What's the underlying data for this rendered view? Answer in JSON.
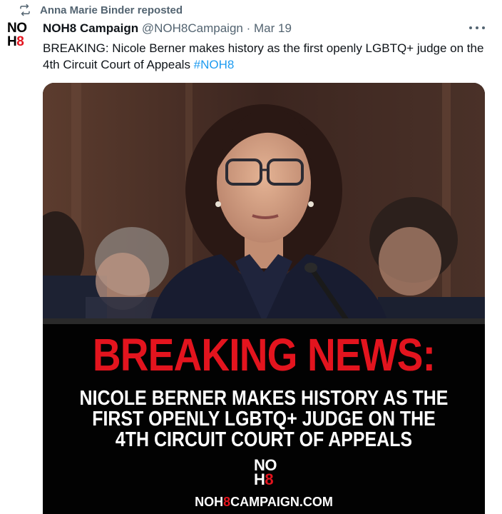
{
  "repost": {
    "icon": "repost-icon",
    "label": "Anna Marie Binder reposted"
  },
  "avatar": {
    "line1": "NO",
    "line2_prefix": "H",
    "line2_red": "8"
  },
  "author": {
    "name": "NOH8 Campaign",
    "handle": "@NOH8Campaign",
    "separator": "·",
    "date": "Mar 19"
  },
  "more_icon": "more-horizontal-icon",
  "post": {
    "text": "BREAKING: Nicole Berner makes history as the first openly LGBTQ+ judge on the 4th Circuit Court of Appeals ",
    "hashtag": "#NOH8"
  },
  "media": {
    "banner_title": "BREAKING NEWS:",
    "banner_lines": [
      "NICOLE BERNER MAKES HISTORY AS THE",
      "FIRST OPENLY LGBTQ+ JUDGE ON THE",
      "4TH CIRCUIT COURT OF APPEALS"
    ],
    "logo_line1": "NO",
    "logo_line2_prefix": "H",
    "logo_line2_red": "8",
    "url_prefix": "NOH",
    "url_red": "8",
    "url_suffix": "CAMPAIGN.COM"
  },
  "colors": {
    "accent": "#1d9bf0",
    "brand_red": "#e3141e",
    "muted": "#536471"
  }
}
